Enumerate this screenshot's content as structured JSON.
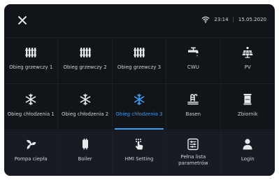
{
  "status": {
    "time": "23:14",
    "date": "15.05.2020",
    "separator": "|"
  },
  "icons": {
    "close": "close-icon",
    "wifi": "wifi-icon"
  },
  "colors": {
    "background": "#111419",
    "accent": "#3d9bf0",
    "text": "#cfd4d9"
  },
  "tiles_row1": [
    {
      "label": "Obieg grzewczy 1",
      "icon": "radiator-icon"
    },
    {
      "label": "Obieg grzewczy 2",
      "icon": "radiator-icon"
    },
    {
      "label": "Obieg grzewczy 3",
      "icon": "radiator-icon"
    },
    {
      "label": "CWU",
      "icon": "faucet-icon"
    },
    {
      "label": "PV",
      "icon": "solar-panel-icon"
    }
  ],
  "tiles_row2": [
    {
      "label": "Obieg chłodzenia 1",
      "icon": "snowflake-icon"
    },
    {
      "label": "Obieg chłodzenia 2",
      "icon": "snowflake-icon"
    },
    {
      "label": "Obieg chłodzenia 3",
      "icon": "snowflake-icon",
      "active": true
    },
    {
      "label": "Basen",
      "icon": "pool-icon"
    },
    {
      "label": "Zbiornik",
      "icon": "tank-icon"
    }
  ],
  "tiles_row3": [
    {
      "label": "Pompa ciepła",
      "icon": "fan-icon"
    },
    {
      "label": "Boiler",
      "icon": "boiler-icon"
    },
    {
      "label": "HMI Setting",
      "icon": "touch-settings-icon"
    },
    {
      "label": "Pełna lista parametrów",
      "icon": "sliders-icon"
    },
    {
      "label": "Login",
      "icon": "user-icon"
    }
  ]
}
